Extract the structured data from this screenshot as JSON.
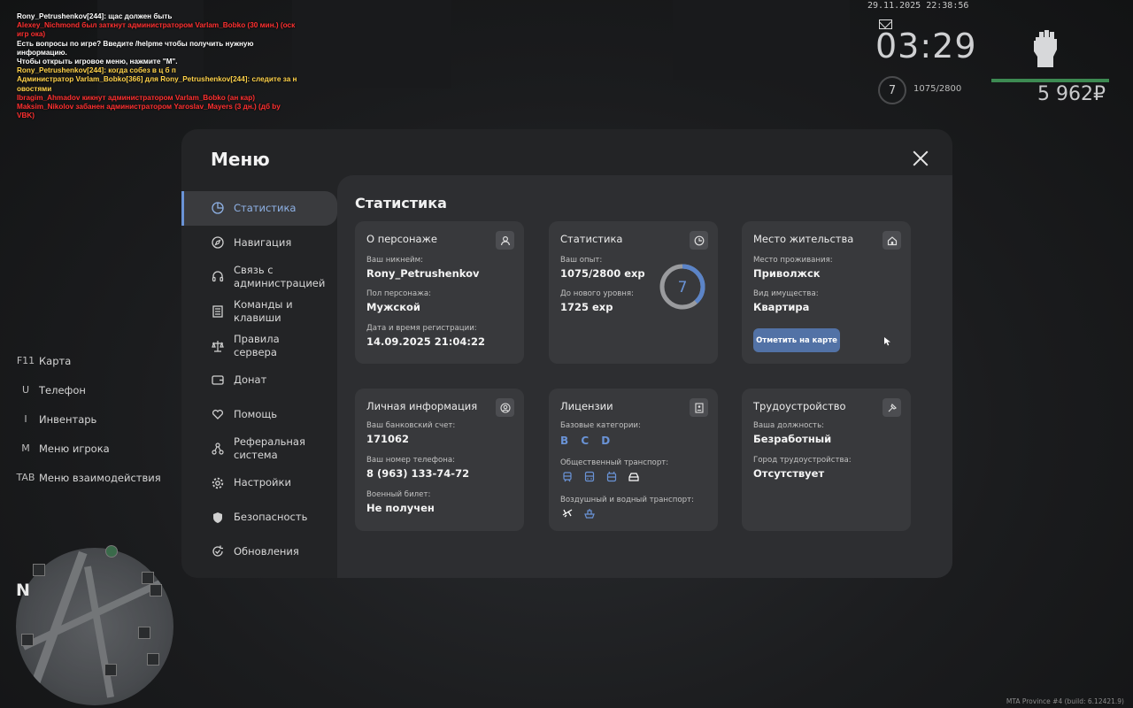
{
  "chat": [
    {
      "text": "Rony_Petrushenkov[244]: щас должен быть",
      "color": "#ffffff"
    },
    {
      "text": "Alexey_Nichmond был заткнут администратором Varlam_Bobko (30 мин.) (оск игр ока)",
      "color": "#ff3030"
    },
    {
      "text": "Есть вопросы по игре? Введите /helpme чтобы получить нужную информацию.",
      "color": "#ffffff"
    },
    {
      "text": "Чтобы открыть игровое меню, нажмите \"M\".",
      "color": "#ffffff"
    },
    {
      "text": "Rony_Petrushenkov[244]: когда собез в ц б п",
      "color": "#ffd24a"
    },
    {
      "text": "Администратор Varlam_Bobko[366] для Rony_Petrushenkov[244]: следите за н овостями",
      "color": "#ffd24a"
    },
    {
      "text": "Ibragim_Ahmadov кикнут администратором Varlam_Bobko (ан кар)",
      "color": "#ff3030"
    },
    {
      "text": "Maksim_Nikolov забанен администратором Yaroslav_Mayers (3 дн.) (дб by VBK)",
      "color": "#ff3030"
    }
  ],
  "hud": {
    "datetime": "29.11.2025 22:38:56",
    "time": "03:29",
    "level": "7",
    "exp": "1075/2800",
    "money": "5 962₽",
    "health_color": "#3d8a52"
  },
  "keybinds": [
    {
      "key": "F11",
      "label": "Карта"
    },
    {
      "key": "U",
      "label": "Телефон"
    },
    {
      "key": "I",
      "label": "Инвентарь"
    },
    {
      "key": "M",
      "label": "Меню игрока"
    },
    {
      "key": "TAB",
      "label": "Меню взаимодействия"
    }
  ],
  "minimap": {
    "north": "N"
  },
  "build": "MTA Province #4 (build: 6.12421.9)",
  "menu": {
    "title": "Меню",
    "sidebar": [
      {
        "label": "Статистика",
        "icon": "pie-chart-icon",
        "active": true
      },
      {
        "label": "Навигация",
        "icon": "compass-icon"
      },
      {
        "label": "Связь с администрацией",
        "icon": "headset-icon"
      },
      {
        "label": "Команды и клавиши",
        "icon": "document-icon"
      },
      {
        "label": "Правила сервера",
        "icon": "scales-icon"
      },
      {
        "label": "Донат",
        "icon": "wallet-icon"
      },
      {
        "label": "Помощь",
        "icon": "heart-hand-icon"
      },
      {
        "label": "Реферальная система",
        "icon": "referral-icon"
      },
      {
        "label": "Настройки",
        "icon": "gear-icon"
      },
      {
        "label": "Безопасность",
        "icon": "shield-icon"
      },
      {
        "label": "Обновления",
        "icon": "update-icon"
      }
    ],
    "content_title": "Статистика",
    "cards": {
      "character": {
        "title": "О персонаже",
        "nickname_label": "Ваш никнейм:",
        "nickname": "Rony_Petrushenkov",
        "gender_label": "Пол персонажа:",
        "gender": "Мужской",
        "reg_label": "Дата и время регистрации:",
        "reg": "14.09.2025 21:04:22"
      },
      "stats": {
        "title": "Статистика",
        "exp_label": "Ваш опыт:",
        "exp": "1075/2800 exp",
        "next_label": "До нового уровня:",
        "next": "1725 exp",
        "level": "7",
        "progress": 0.384
      },
      "residence": {
        "title": "Место жительства",
        "place_label": "Место проживания:",
        "place": "Приволжск",
        "property_label": "Вид имущества:",
        "property": "Квартира",
        "button": "Отметить на карте"
      },
      "personal": {
        "title": "Личная информация",
        "bank_label": "Ваш банковский счет:",
        "bank": "171062",
        "phone_label": "Ваш номер телефона:",
        "phone": "8 (963) 133-74-72",
        "military_label": "Военный билет:",
        "military": "Не получен"
      },
      "licenses": {
        "title": "Лицензии",
        "basic_label": "Базовые категории:",
        "basic": "B C D",
        "public_label": "Общественный транспорт:",
        "air_label": "Воздушный и водный транспорт:"
      },
      "job": {
        "title": "Трудоустройство",
        "position_label": "Ваша должность:",
        "position": "Безработный",
        "city_label": "Город трудоустройства:",
        "city": "Отсутствует"
      }
    }
  }
}
